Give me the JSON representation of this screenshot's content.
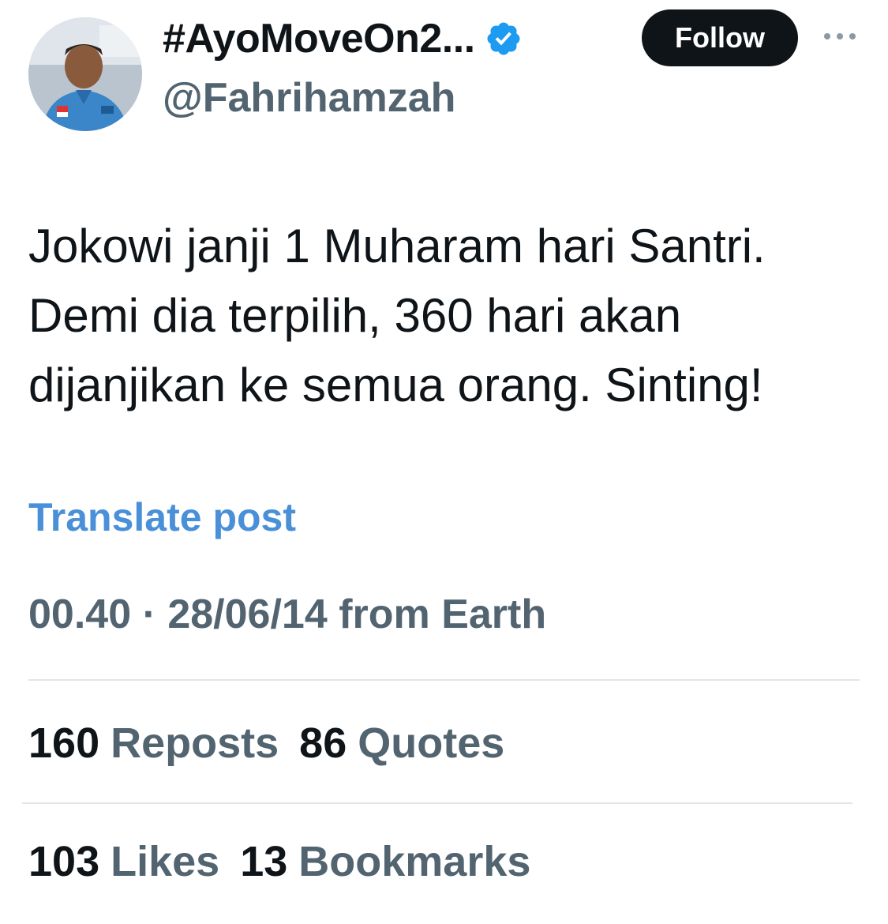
{
  "author": {
    "display_name": "#AyoMoveOn2...",
    "handle": "@Fahrihamzah",
    "verified": true,
    "verified_icon": "verified-badge-icon",
    "verified_color": "#1d9bf0"
  },
  "actions": {
    "follow_label": "Follow",
    "more_icon": "more-horizontal-icon"
  },
  "tweet": {
    "lines": [
      "Jokowi janji 1 Muharam hari Santri.",
      "Demi dia terpilih, 360 hari akan",
      "dijanjikan ke semua orang. Sinting!"
    ],
    "translate_label": "Translate post",
    "meta": "00.40 · 28/06/14 from Earth"
  },
  "stats": {
    "reposts": {
      "count": "160",
      "label": "Reposts"
    },
    "quotes": {
      "count": "86",
      "label": "Quotes"
    },
    "likes": {
      "count": "103",
      "label": "Likes"
    },
    "bookmarks": {
      "count": "13",
      "label": "Bookmarks"
    }
  },
  "colors": {
    "text_primary": "#0f1419",
    "text_secondary": "#536471",
    "link": "#4a90d9",
    "divider": "#e1e6ea"
  }
}
